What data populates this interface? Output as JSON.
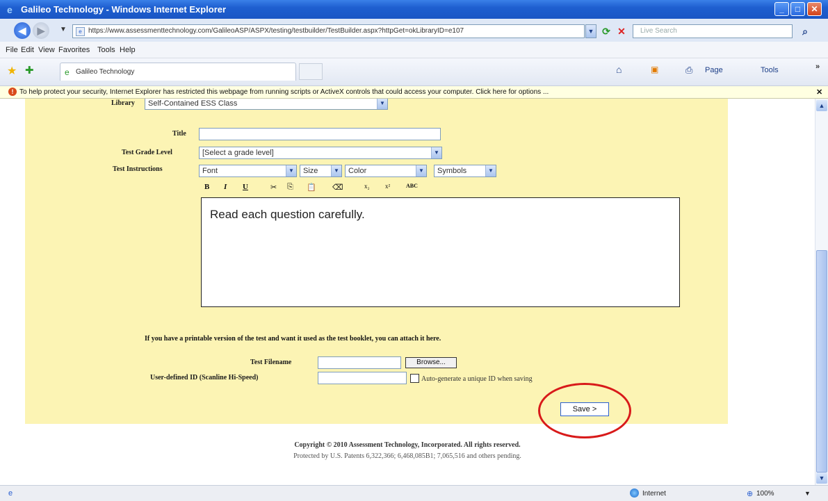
{
  "window": {
    "title": "Galileo Technology - Windows Internet Explorer",
    "min": "_",
    "max": "□",
    "close": "✕"
  },
  "address": {
    "url": "https://www.assessmenttechnology.com/GalileoASP/ASPX/testing/testbuilder/TestBuilder.aspx?httpGet=okLibraryID=e107",
    "search_placeholder": "Live Search"
  },
  "menu": [
    "File",
    "Edit",
    "View",
    "Favorites",
    "Tools",
    "Help"
  ],
  "tab": {
    "label": "Galileo Technology"
  },
  "toolbar": {
    "page": "Page",
    "tools": "Tools"
  },
  "infobar": {
    "message": "To help protect your security, Internet Explorer has restricted this webpage from running scripts or ActiveX controls that could access your computer. Click here for options ..."
  },
  "form": {
    "library_label": "Library",
    "library_value": "Self-Contained ESS Class",
    "title_label": "Title",
    "title_value": "",
    "grade_label": "Test Grade Level",
    "grade_value": "[Select a grade level]",
    "instructions_label": "Test Instructions",
    "font_select": "Font",
    "size_select": "Size",
    "color_select": "Color",
    "symbols_select": "Symbols",
    "format_buttons": [
      "B",
      "I",
      "U",
      "✂",
      "⎘",
      "📋",
      "⌫",
      "x₂",
      "x²",
      "ABC"
    ],
    "editor_text": "Read each question carefully.",
    "attach_note": "If you have a printable version of the test and want it used as the test booklet, you can attach it here.",
    "filename_label": "Test Filename",
    "browse_label": "Browse...",
    "userid_label": "User-defined ID (Scanline Hi-Speed)",
    "autogen_label": "Auto-generate a unique ID when saving",
    "save_label": "Save >"
  },
  "footer": {
    "copyright": "Copyright © 2010 Assessment Technology, Incorporated. All rights reserved.",
    "patents": "Protected by U.S. Patents 6,322,366; 6,468,085B1; 7,065,516 and others pending."
  },
  "status": {
    "zone": "Internet",
    "zoom": "100%"
  },
  "colors": {
    "panel": "#fcf4b4",
    "highlight_circle": "#d81a1a",
    "titlebar": "#1e5fd0"
  }
}
